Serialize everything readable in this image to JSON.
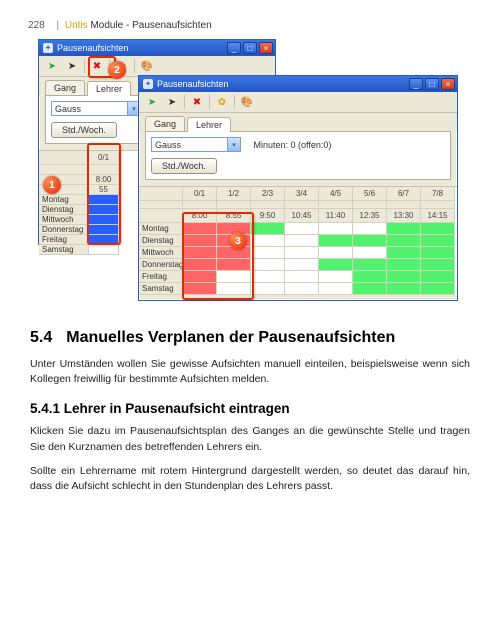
{
  "header": {
    "page_number": "228",
    "brand": "Untis",
    "section": "Module - Pausenaufsichten"
  },
  "window_a": {
    "title": "Pausenaufsichten",
    "toolbar_icons": [
      "green-run-icon",
      "black-run-icon",
      "x-red-icon",
      "color-icon"
    ],
    "tab1": "Gang",
    "tab2": "Lehrer",
    "combo_value": "Gauss",
    "button_label": "Std./Woch.",
    "col_head": "0/1",
    "time_blank": "",
    "time_row2": "8:00",
    "time_row3": "55",
    "days": [
      "Montag",
      "Dienstag",
      "Mittwoch",
      "Donnerstag",
      "Freitag",
      "Samstag"
    ]
  },
  "window_b": {
    "title": "Pausenaufsichten",
    "toolbar_icons": [
      "green-run-icon",
      "black-run-icon",
      "x-red-icon",
      "color-icon"
    ],
    "tab1": "Gang",
    "tab2": "Lehrer",
    "combo_value": "Gauss",
    "minutes_label": "Minuten: 0 (offen:0)",
    "button_label": "Std./Woch.",
    "cols": [
      "0/1",
      "1/2",
      "2/3",
      "3/4",
      "4/5",
      "5/6",
      "6/7",
      "7/8"
    ],
    "time_blank": "",
    "times": [
      "8:00",
      "8:55",
      "9:50",
      "10:45",
      "11:40",
      "12:35",
      "13:30",
      "14:15"
    ],
    "days": [
      "Montag",
      "Dienstag",
      "Mittwoch",
      "Donnerstag",
      "Freitag",
      "Samstag"
    ]
  },
  "callouts": {
    "one": "1",
    "two": "2",
    "three": "3"
  },
  "article": {
    "h1_num": "5.4",
    "h1_text": "Manuelles Verplanen der Pausenaufsichten",
    "p1": "Unter Umständen wollen Sie gewisse Aufsichten manuell einteilen, beispielsweise wenn sich Kollegen freiwillig für bestimmte Aufsichten melden.",
    "h2": "5.4.1 Lehrer in Pausenaufsicht eintragen",
    "p2": "Klicken Sie dazu im Pausenaufsichtsplan des Ganges an die gewünschte Stelle und tragen Sie den Kurznamen des betreffenden Lehrers ein.",
    "p3": "Sollte ein Lehrername mit rotem Hintergrund dargestellt werden, so deutet das darauf hin, dass die Aufsicht schlecht in den Stundenplan des Lehrers passt."
  }
}
